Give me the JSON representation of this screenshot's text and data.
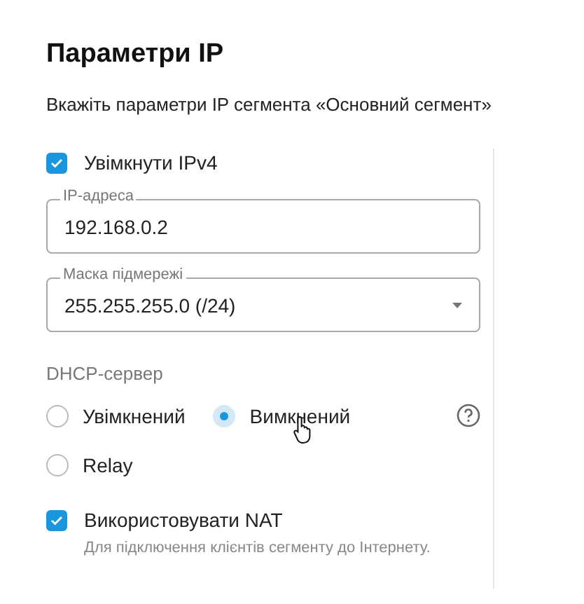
{
  "title": "Параметри IP",
  "subtitle": "Вкажіть параметри IP сегмента «Основний сегмент»",
  "ipv4": {
    "label": "Увімкнути IPv4",
    "checked": true
  },
  "ip_field": {
    "label": "IP-адреса",
    "value": "192.168.0.2"
  },
  "mask_field": {
    "label": "Маска підмережі",
    "value": "255.255.255.0 (/24)"
  },
  "dhcp": {
    "label": "DHCP-сервер",
    "options": [
      {
        "label": "Увімкнений",
        "selected": false
      },
      {
        "label": "Вимкнений",
        "selected": true
      },
      {
        "label": "Relay",
        "selected": false
      }
    ]
  },
  "nat": {
    "label": "Використовувати NAT",
    "checked": true,
    "hint": "Для підключення клієнтів сегменту до Інтернету."
  }
}
